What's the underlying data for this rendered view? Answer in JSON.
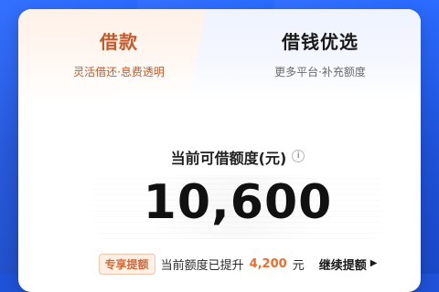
{
  "tabs": [
    {
      "title": "借款",
      "subtitle": "灵活借还·息费透明"
    },
    {
      "title": "借钱优选",
      "subtitle": "更多平台·补充额度"
    }
  ],
  "limit": {
    "title": "当前可借额度(元)",
    "amount": "10,600"
  },
  "promo": {
    "badge": "专享提额",
    "prefix": "当前额度已提升",
    "value": "4,200",
    "suffix": "元",
    "cta": "继续提额"
  },
  "icons": {
    "info": "info-icon",
    "chevron": "chevron-right-icon"
  },
  "colors": {
    "brand_blue": "#1f52d8",
    "accent_orange": "#f06c2a"
  }
}
